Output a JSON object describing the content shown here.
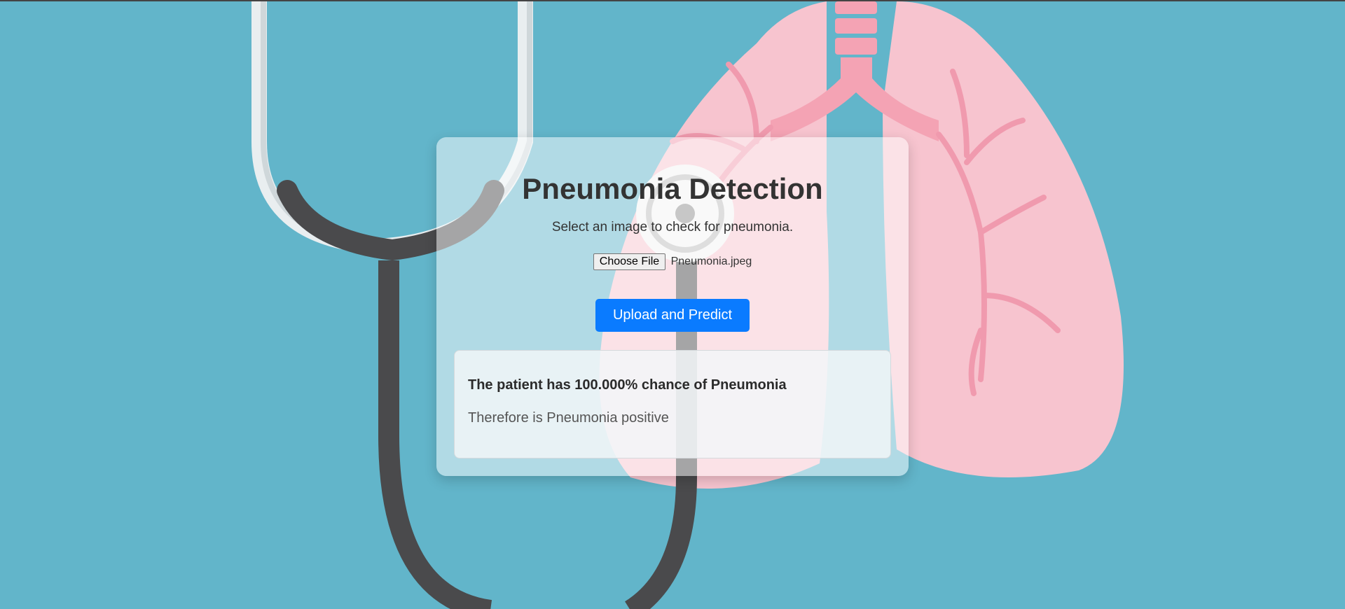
{
  "main": {
    "title": "Pneumonia Detection",
    "subtitle": "Select an image to check for pneumonia.",
    "file_button": "Choose File",
    "file_name": "Pneumonia.jpeg",
    "predict_button": "Upload and Predict"
  },
  "result": {
    "headline": "The patient has 100.000% chance of Pneumonia",
    "conclusion": "Therefore is Pneumonia positive"
  },
  "colors": {
    "background": "#62b5ca",
    "accent": "#0a7bff",
    "lung": "#f7c4cf",
    "stethoscope": "#4a4a4c"
  },
  "background_art": {
    "icons": [
      "stethoscope-icon",
      "lungs-icon"
    ]
  }
}
